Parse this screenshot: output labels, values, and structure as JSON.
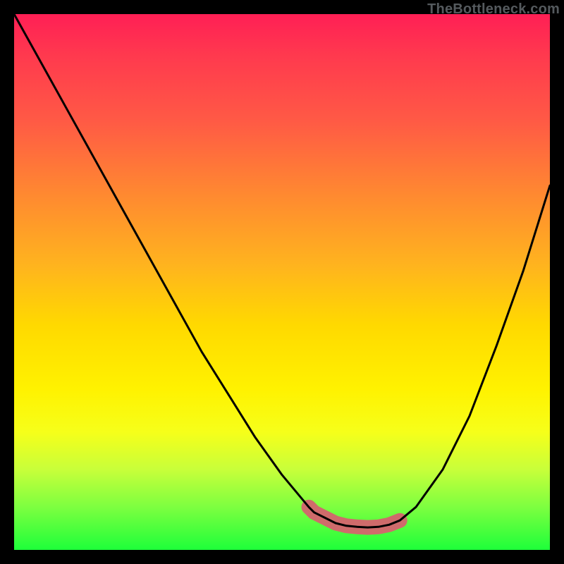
{
  "watermark": {
    "text": "TheBottleneck.com"
  },
  "chart_data": {
    "type": "line",
    "title": "",
    "xlabel": "",
    "ylabel": "",
    "xlim": [
      0,
      100
    ],
    "ylim": [
      0,
      100
    ],
    "series": [
      {
        "name": "main-curve",
        "x": [
          0,
          5,
          10,
          15,
          20,
          25,
          30,
          35,
          40,
          45,
          50,
          55,
          56,
          58,
          60,
          62,
          64,
          66,
          68,
          70,
          72,
          75,
          80,
          85,
          90,
          95,
          100
        ],
        "values": [
          100,
          91,
          82,
          73,
          64,
          55,
          46,
          37,
          29,
          21,
          14,
          8,
          7,
          6,
          5,
          4.5,
          4.3,
          4.2,
          4.3,
          4.7,
          5.5,
          8,
          15,
          25,
          38,
          52,
          68
        ]
      }
    ],
    "valley_band": {
      "x_start": 55,
      "x_end": 72,
      "y": 4.5,
      "thickness": 3
    },
    "colors": {
      "curve": "#000000",
      "valley_band": "#cf6b6b"
    }
  }
}
